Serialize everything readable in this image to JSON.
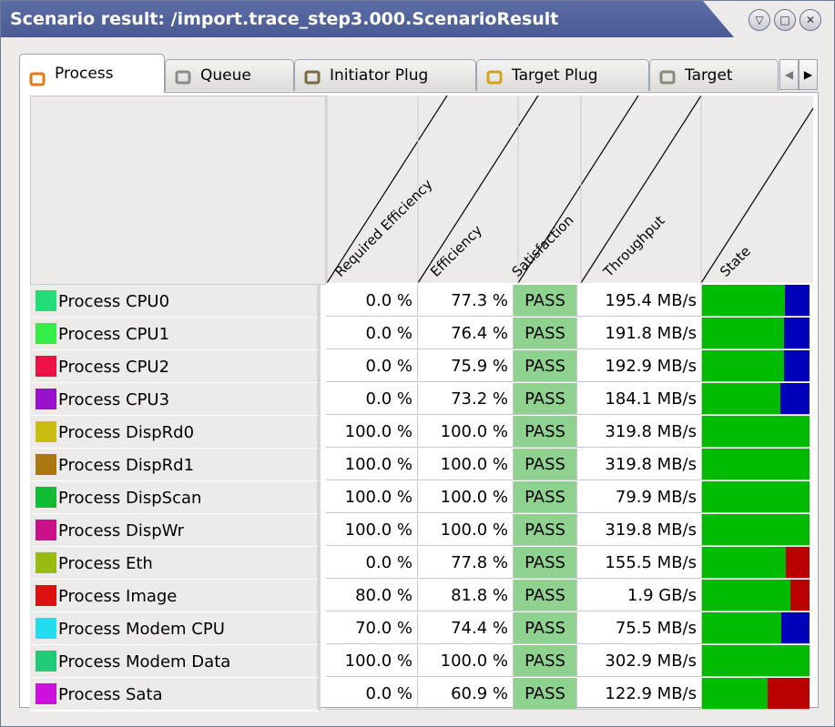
{
  "window": {
    "title": "Scenario result: /import.trace_step3.000.ScenarioResult",
    "controls": [
      {
        "name": "minimize-button",
        "glyph": "▽"
      },
      {
        "name": "maximize-button",
        "glyph": "□"
      },
      {
        "name": "close-button",
        "glyph": "✕"
      }
    ]
  },
  "tabs": [
    {
      "label": "Process",
      "icon": "process-icon",
      "icon_color": "#e07a1a",
      "active": true
    },
    {
      "label": "Queue",
      "icon": "queue-icon",
      "icon_color": "#8a8a8a",
      "active": false
    },
    {
      "label": "Initiator Plug",
      "icon": "initiator-plug-icon",
      "icon_color": "#7a6a40",
      "active": false
    },
    {
      "label": "Target Plug",
      "icon": "target-plug-icon",
      "icon_color": "#d6a21a",
      "active": false
    },
    {
      "label": "Target",
      "icon": "target-icon",
      "icon_color": "#8a8a7a",
      "active": false
    }
  ],
  "columns": [
    "Required Efficiency",
    "Efficiency",
    "Satisfaction",
    "Throughput",
    "State"
  ],
  "colors": {
    "pass": "#8fd18f",
    "state_green": "#00bb00",
    "state_blue": "#0000bb",
    "state_red": "#bb0000"
  },
  "rows": [
    {
      "name": "Process CPU0",
      "color": "#22dd77",
      "required": "0.0 %",
      "efficiency": "77.3 %",
      "satisfaction": "PASS",
      "throughput": "195.4 MB/s",
      "state": [
        [
          "green",
          0.77
        ],
        [
          "blue",
          0.23
        ]
      ]
    },
    {
      "name": "Process CPU1",
      "color": "#33ee44",
      "required": "0.0 %",
      "efficiency": "76.4 %",
      "satisfaction": "PASS",
      "throughput": "191.8 MB/s",
      "state": [
        [
          "green",
          0.76
        ],
        [
          "blue",
          0.24
        ]
      ]
    },
    {
      "name": "Process CPU2",
      "color": "#ee1144",
      "required": "0.0 %",
      "efficiency": "75.9 %",
      "satisfaction": "PASS",
      "throughput": "192.9 MB/s",
      "state": [
        [
          "green",
          0.76
        ],
        [
          "blue",
          0.24
        ]
      ]
    },
    {
      "name": "Process CPU3",
      "color": "#9911cc",
      "required": "0.0 %",
      "efficiency": "73.2 %",
      "satisfaction": "PASS",
      "throughput": "184.1 MB/s",
      "state": [
        [
          "green",
          0.73
        ],
        [
          "blue",
          0.27
        ]
      ]
    },
    {
      "name": "Process DispRd0",
      "color": "#ccbb11",
      "required": "100.0 %",
      "efficiency": "100.0 %",
      "satisfaction": "PASS",
      "throughput": "319.8 MB/s",
      "state": [
        [
          "green",
          1.0
        ]
      ]
    },
    {
      "name": "Process DispRd1",
      "color": "#aa7711",
      "required": "100.0 %",
      "efficiency": "100.0 %",
      "satisfaction": "PASS",
      "throughput": "319.8 MB/s",
      "state": [
        [
          "green",
          1.0
        ]
      ]
    },
    {
      "name": "Process DispScan",
      "color": "#11bb33",
      "required": "100.0 %",
      "efficiency": "100.0 %",
      "satisfaction": "PASS",
      "throughput": "79.9 MB/s",
      "state": [
        [
          "green",
          1.0
        ]
      ]
    },
    {
      "name": "Process DispWr",
      "color": "#cc1188",
      "required": "100.0 %",
      "efficiency": "100.0 %",
      "satisfaction": "PASS",
      "throughput": "319.8 MB/s",
      "state": [
        [
          "green",
          1.0
        ]
      ]
    },
    {
      "name": "Process Eth",
      "color": "#99bb11",
      "required": "0.0 %",
      "efficiency": "77.8 %",
      "satisfaction": "PASS",
      "throughput": "155.5 MB/s",
      "state": [
        [
          "green",
          0.78
        ],
        [
          "red",
          0.22
        ]
      ]
    },
    {
      "name": "Process Image",
      "color": "#dd1111",
      "required": "80.0 %",
      "efficiency": "81.8 %",
      "satisfaction": "PASS",
      "throughput": "1.9 GB/s",
      "state": [
        [
          "green",
          0.82
        ],
        [
          "red",
          0.18
        ]
      ]
    },
    {
      "name": "Process Modem CPU",
      "color": "#22ddee",
      "required": "70.0 %",
      "efficiency": "74.4 %",
      "satisfaction": "PASS",
      "throughput": "75.5 MB/s",
      "state": [
        [
          "green",
          0.74
        ],
        [
          "blue",
          0.26
        ]
      ]
    },
    {
      "name": "Process Modem Data",
      "color": "#22cc77",
      "required": "100.0 %",
      "efficiency": "100.0 %",
      "satisfaction": "PASS",
      "throughput": "302.9 MB/s",
      "state": [
        [
          "green",
          1.0
        ]
      ]
    },
    {
      "name": "Process Sata",
      "color": "#cc11dd",
      "required": "0.0 %",
      "efficiency": "60.9 %",
      "satisfaction": "PASS",
      "throughput": "122.9 MB/s",
      "state": [
        [
          "green",
          0.61
        ],
        [
          "red",
          0.39
        ]
      ]
    }
  ]
}
